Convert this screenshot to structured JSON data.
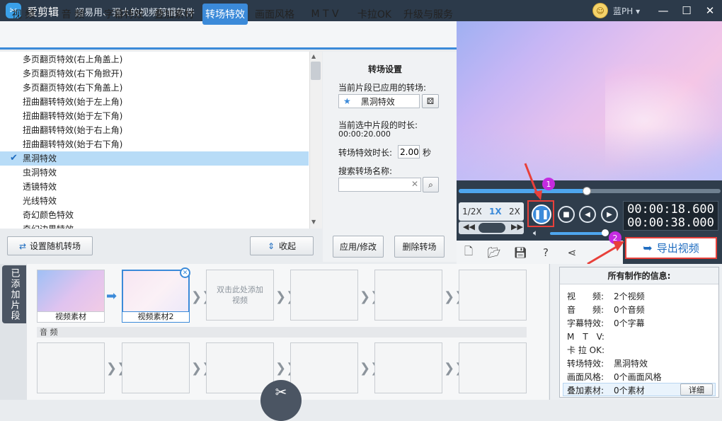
{
  "app": {
    "title": "爱剪辑",
    "slogan": "超易用、强大的视频剪辑软件",
    "user": "蓝PH"
  },
  "tabs": [
    "视 频",
    "音 频",
    "字幕特效",
    "叠加素材",
    "转场特效",
    "画面风格",
    "M T V",
    "卡拉OK",
    "升级与服务"
  ],
  "effects": [
    "多页翻页特效(右上角盖上)",
    "多页翻页特效(右下角掀开)",
    "多页翻页特效(右下角盖上)",
    "扭曲翻转特效(始于左上角)",
    "扭曲翻转特效(始于左下角)",
    "扭曲翻转特效(始于右上角)",
    "扭曲翻转特效(始于右下角)",
    "黑洞特效",
    "虫洞特效",
    "透镜特效",
    "光线特效",
    "奇幻颜色特效",
    "奇幻边界特效"
  ],
  "left_buttons": {
    "random": "设置随机转场",
    "collapse": "收起"
  },
  "settings": {
    "title": "转场设置",
    "applied_label": "当前片段已应用的转场:",
    "applied_value": "黑洞特效",
    "duration_label": "当前选中片段的时长:",
    "duration_value": "00:00:20.000",
    "effect_len_label": "转场特效时长:",
    "effect_len_value": "2.00",
    "effect_len_unit": "秒",
    "search_label": "搜索转场名称:",
    "search_value": "",
    "apply_btn": "应用/修改",
    "delete_btn": "删除转场"
  },
  "player": {
    "speeds": [
      "1/2X",
      "1X",
      "2X"
    ],
    "current_time": "00:00:18.600",
    "total_time": "00:00:38.000",
    "progress": 0.49,
    "export_label": "导出视频",
    "badge1": "1",
    "badge2": "2"
  },
  "timeline": {
    "side_label": "已添加片段",
    "clips": [
      "视频素材",
      "视频素材2"
    ],
    "add_hint": "双击此处添加视频",
    "audio_label": "音 频"
  },
  "info": {
    "title": "所有制作的信息:",
    "rows": [
      {
        "k": "视　　频:",
        "v": "2个视频"
      },
      {
        "k": "音　　频:",
        "v": "0个音频"
      },
      {
        "k": "字幕特效:",
        "v": "0个字幕"
      },
      {
        "k": "M　T　V:",
        "v": ""
      },
      {
        "k": "卡 拉 OK:",
        "v": ""
      },
      {
        "k": "转场特效:",
        "v": "黑洞特效"
      },
      {
        "k": "画面风格:",
        "v": "0个画面风格"
      },
      {
        "k": "叠加素材:",
        "v": "0个素材"
      }
    ],
    "detail_btn": "详细"
  },
  "colors": {
    "accent": "#3b8ad9",
    "annotation": "#e8403a",
    "badge": "#c42be0"
  }
}
